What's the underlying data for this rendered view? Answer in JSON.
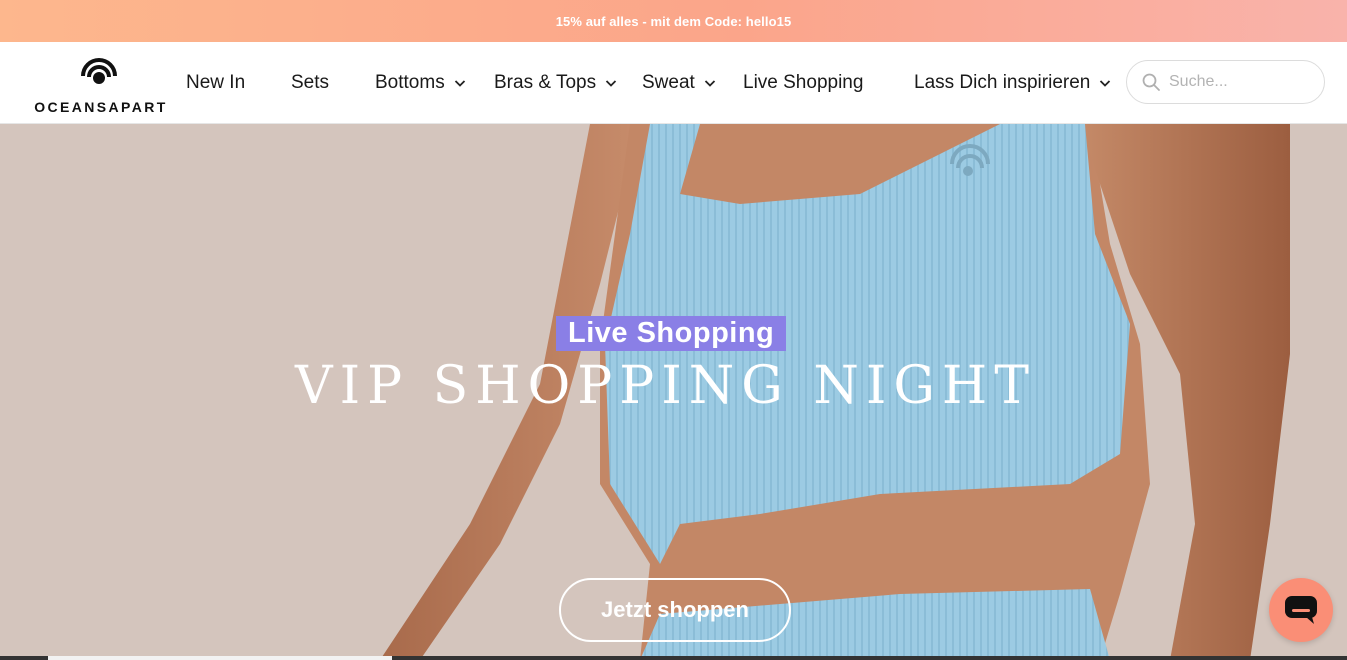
{
  "promo": {
    "text": "15% auf alles - mit dem Code: hello15"
  },
  "brand": {
    "name": "OCEANSAPART"
  },
  "nav": [
    {
      "label": "New In",
      "has_dropdown": false
    },
    {
      "label": "Sets",
      "has_dropdown": false
    },
    {
      "label": "Bottoms",
      "has_dropdown": true
    },
    {
      "label": "Bras & Tops",
      "has_dropdown": true
    },
    {
      "label": "Sweat",
      "has_dropdown": true
    },
    {
      "label": "Live Shopping",
      "has_dropdown": false
    },
    {
      "label": "Lass Dich inspirieren",
      "has_dropdown": true
    }
  ],
  "search": {
    "placeholder": "Suche...",
    "value": "",
    "icon": "search-icon"
  },
  "hero": {
    "badge": "Live Shopping",
    "title": "VIP SHOPPING NIGHT",
    "cta": "Jetzt shoppen"
  },
  "chat": {
    "icon": "chat-icon"
  },
  "colors": {
    "promo_gradient_start": "#fdb78d",
    "promo_gradient_end": "#f9b3ab",
    "badge_bg": "#8a7fe6",
    "hero_bg": "#d4c5bd",
    "top_color": "#9ccbe3",
    "chat_bg": "#fa8e76"
  }
}
